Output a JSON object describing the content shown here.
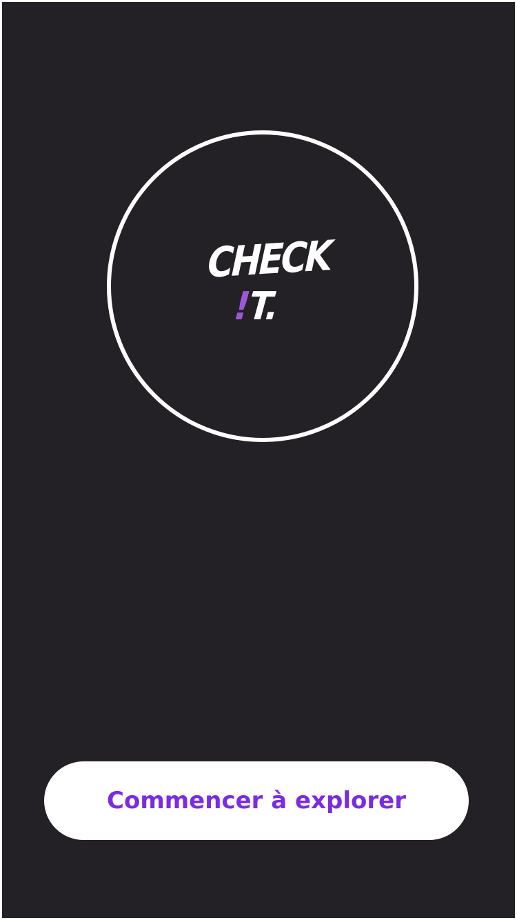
{
  "app": {
    "logo_line1": "CHECK",
    "logo_exclaim": "!",
    "logo_line2_rest": "T."
  },
  "actions": {
    "start_label": "Commencer à explorer"
  },
  "colors": {
    "background": "#232026",
    "ring": "#ffffff",
    "accent": "#7b2be0",
    "logo_exclaim": "#9b59d6",
    "button_bg": "#ffffff"
  }
}
